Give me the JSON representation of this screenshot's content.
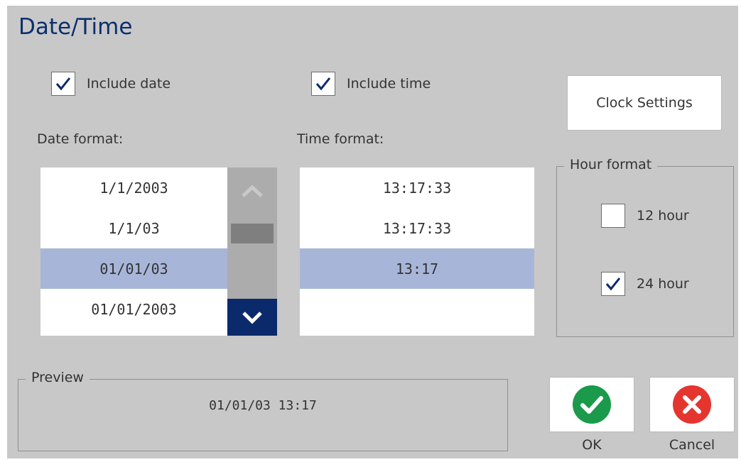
{
  "title": "Date/Time",
  "include_date": {
    "label": "Include date",
    "checked": true
  },
  "include_time": {
    "label": "Include time",
    "checked": true
  },
  "clock_settings_label": "Clock Settings",
  "date_format": {
    "label": "Date format:",
    "items": [
      "1/1/2003",
      "1/1/03",
      "01/01/03",
      "01/01/2003"
    ],
    "selected_index": 2
  },
  "time_format": {
    "label": "Time format:",
    "items": [
      "13:17:33",
      "13:17:33",
      "13:17",
      ""
    ],
    "selected_index": 2
  },
  "hour_format": {
    "legend": "Hour format",
    "options": [
      {
        "label": "12 hour",
        "checked": false
      },
      {
        "label": "24 hour",
        "checked": true
      }
    ]
  },
  "preview": {
    "legend": "Preview",
    "value": "01/01/03 13:17"
  },
  "ok_label": "OK",
  "cancel_label": "Cancel",
  "colors": {
    "background": "#c8c8c8",
    "title": "#0b2f6f",
    "selection": "#a7b6d8",
    "scroll_down": "#0b2a6c",
    "ok": "#1a9a4a",
    "cancel": "#e4352f"
  },
  "icons": {
    "checkmark": "checkmark-icon",
    "scroll_up": "chevron-up-icon",
    "scroll_down": "chevron-down-icon",
    "ok": "ok-check-circle-icon",
    "cancel": "cancel-x-circle-icon"
  }
}
